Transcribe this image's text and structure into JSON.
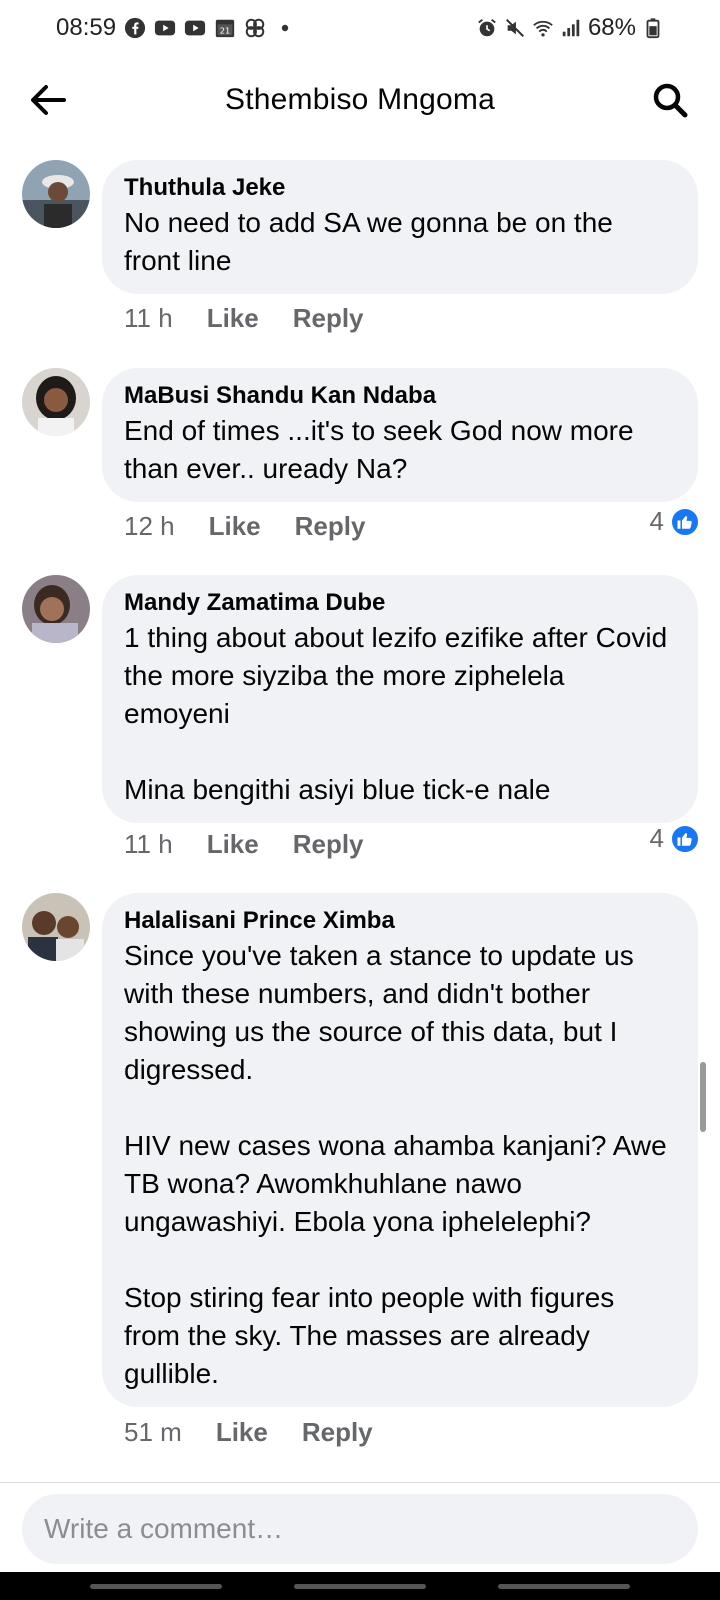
{
  "status_bar": {
    "time": "08:59",
    "battery": "68%",
    "left_icons": [
      "facebook-icon",
      "youtube-icon",
      "youtube-icon",
      "calendar-icon",
      "pinwheel-icon",
      "dot-icon"
    ],
    "right_icons": [
      "alarm-icon",
      "mute-icon",
      "wifi-icon",
      "signal-icon",
      "battery-icon"
    ]
  },
  "header": {
    "title": "Sthembiso Mngoma"
  },
  "comments": [
    {
      "author": "Thuthula Jeke",
      "text": "No need to add SA we gonna  be on the front line",
      "time": "11 h",
      "like_label": "Like",
      "reply_label": "Reply",
      "reactions": ""
    },
    {
      "author": "MaBusi Shandu Kan Ndaba",
      "text": "End of times ...it's to seek God now more than ever.. uready Na?",
      "time": "12 h",
      "like_label": "Like",
      "reply_label": "Reply",
      "reactions": "4"
    },
    {
      "author": "Mandy Zamatima Dube",
      "text": "1 thing about about lezifo ezifike after Covid the more siyziba the more ziphelela emoyeni\n\nMina bengithi asiyi blue tick-e nale",
      "time": "11 h",
      "like_label": "Like",
      "reply_label": "Reply",
      "reactions": "4"
    },
    {
      "author": "Halalisani Prince Ximba",
      "text": "Since you've taken a stance to update us with these numbers, and didn't bother showing us the source of this data, but I digressed.\n\nHIV new cases wona ahamba kanjani? Awe TB wona? Awomkhuhlane nawo ungawashiyi. Ebola yona iphelelephi?\n\nStop stiring fear into people with figures from the sky. The masses are already gullible.",
      "time": "51 m",
      "like_label": "Like",
      "reply_label": "Reply",
      "reactions": ""
    }
  ],
  "composer": {
    "placeholder": "Write a comment…"
  },
  "colors": {
    "like_blue": "#1877f2",
    "bubble": "#f0f2f5",
    "meta_gray": "#65676b"
  }
}
